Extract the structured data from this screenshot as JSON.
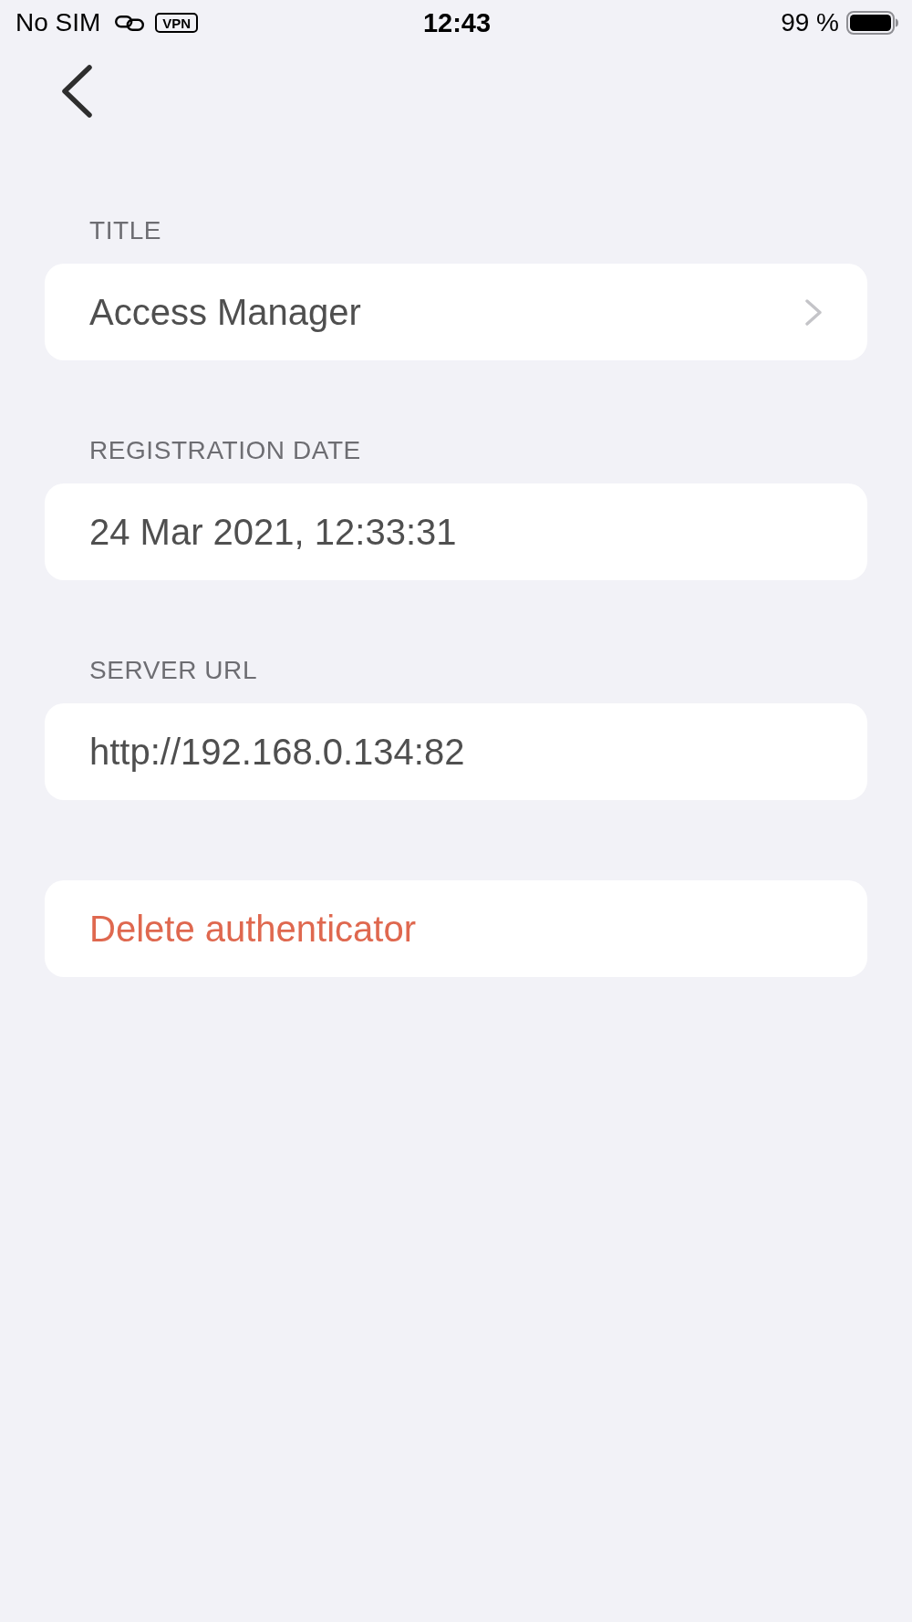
{
  "status_bar": {
    "carrier": "No SIM",
    "vpn": "VPN",
    "time": "12:43",
    "battery": "99 %"
  },
  "fields": [
    {
      "label": "TITLE",
      "value": "Access Manager",
      "kind": "disclosure"
    },
    {
      "label": "REGISTRATION DATE",
      "value": "24 Mar 2021, 12:33:31",
      "kind": "plain"
    },
    {
      "label": "SERVER URL",
      "value": "http://192.168.0.134:82",
      "kind": "plain"
    }
  ],
  "actions": [
    {
      "label": "Delete authenticator",
      "kind": "destructive"
    }
  ]
}
